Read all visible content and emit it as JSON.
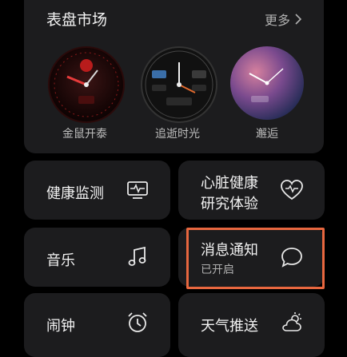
{
  "market": {
    "title": "表盘市场",
    "more_label": "更多",
    "faces": [
      {
        "label": "金鼠开泰"
      },
      {
        "label": "追逝时光"
      },
      {
        "label": "邂逅"
      }
    ]
  },
  "tiles": {
    "health_monitor": {
      "label": "健康监测",
      "icon": "heart-monitor-icon"
    },
    "heart_study": {
      "label_line1": "心脏健康",
      "label_line2": "研究体验",
      "icon": "heart-pulse-icon"
    },
    "music": {
      "label": "音乐",
      "icon": "music-note-icon"
    },
    "notifications": {
      "label": "消息通知",
      "status": "已开启",
      "icon": "chat-bubble-icon"
    },
    "alarm": {
      "label": "闹钟",
      "icon": "alarm-clock-icon"
    },
    "weather": {
      "label": "天气推送",
      "icon": "weather-icon"
    }
  },
  "colors": {
    "highlight": "#e8673f",
    "card": "#1c1c1e"
  }
}
